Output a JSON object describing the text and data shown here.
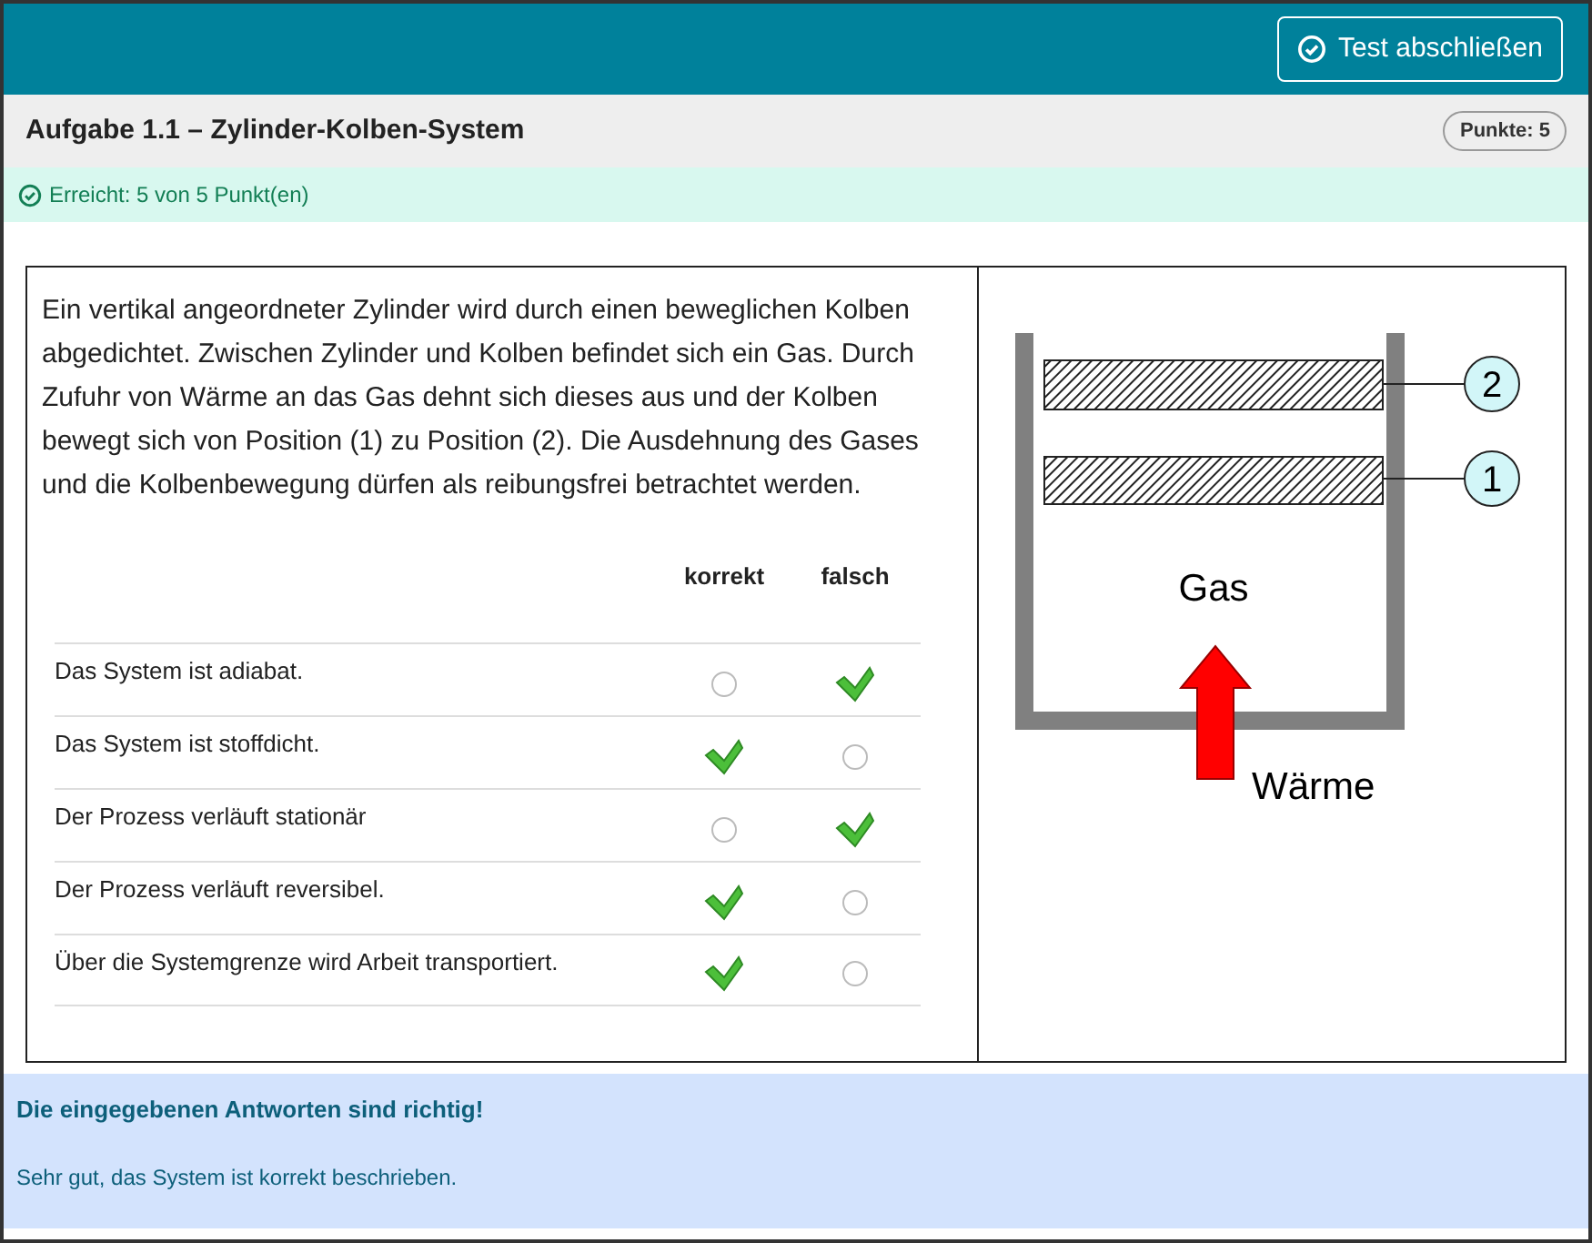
{
  "header": {
    "finish_button": "Test abschließen"
  },
  "task": {
    "title": "Aufgabe 1.1 – Zylinder-Kolben-System",
    "points_badge": "Punkte: 5",
    "result": "Erreicht: 5 von 5 Punkt(en)"
  },
  "question": {
    "text": "Ein vertikal angeordneter Zylinder wird durch einen beweglichen Kolben abgedichtet. Zwischen Zylinder und Kolben befindet sich ein Gas. Durch Zufuhr von Wärme an das Gas dehnt sich dieses aus und der Kolben bewegt sich von Position (1) zu Position (2). Die Ausdehnung des Gases und die Kolbenbewegung dürfen als reibungsfrei betrachtet werden.",
    "columns": [
      "korrekt",
      "falsch"
    ],
    "rows": [
      {
        "statement": "Das System ist adiabat.",
        "options": [
          {
            "selected": false
          },
          {
            "selected": true
          }
        ]
      },
      {
        "statement": "Das System ist stoffdicht.",
        "options": [
          {
            "selected": true
          },
          {
            "selected": false
          }
        ]
      },
      {
        "statement": "Der Prozess verläuft stationär",
        "options": [
          {
            "selected": false
          },
          {
            "selected": true
          }
        ]
      },
      {
        "statement": "Der Prozess verläuft reversibel.",
        "options": [
          {
            "selected": true
          },
          {
            "selected": false
          }
        ]
      },
      {
        "statement": "Über die Systemgrenze wird Arbeit transportiert.",
        "options": [
          {
            "selected": true
          },
          {
            "selected": false
          }
        ]
      }
    ]
  },
  "figure": {
    "position_labels": [
      "2",
      "1"
    ],
    "gas_label": "Gas",
    "heat_label": "Wärme"
  },
  "feedback": {
    "title": "Die eingegebenen Antworten sind richtig!",
    "message": "Sehr gut, das System ist korrekt beschrieben."
  }
}
